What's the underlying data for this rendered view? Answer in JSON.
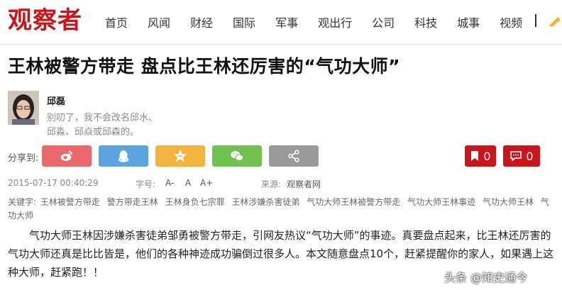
{
  "header": {
    "logo": "观察者",
    "nav": [
      "首页",
      "风闻",
      "财经",
      "国际",
      "军事",
      "观出行",
      "公司",
      "科技",
      "城事",
      "视频"
    ],
    "nav_separator": "|"
  },
  "article": {
    "title": "王林被警方带走 盘点比王林还厉害的“气功大师”",
    "author": {
      "name": "邱磊",
      "bio_line1": "别叨了，我不会改名邱水、",
      "bio_line2": "邱淼、邱焱或邱森的。"
    },
    "share": {
      "label": "分享到:",
      "buttons": [
        {
          "icon": "weibo-icon",
          "color": "#e9686b"
        },
        {
          "icon": "qq-icon",
          "color": "#5ba4e0"
        },
        {
          "icon": "qzone-star-icon",
          "color": "#f3b33f"
        },
        {
          "icon": "wechat-icon",
          "color": "#6fc24f"
        },
        {
          "icon": "share-icon",
          "color": "#9a9a9a"
        }
      ],
      "bookmark_count": "0",
      "comment_count": "0"
    },
    "meta": {
      "date": "2015-07-17 00:40:29",
      "font_label": "字号:",
      "font_small": "A-",
      "font_normal": "A",
      "font_large": "A+",
      "source_label": "来源:",
      "source": "观察者网"
    },
    "keywords": {
      "label": "关键字:",
      "items": [
        "王林被警方带走",
        "警方带走王林",
        "王林身负七宗罪",
        "王林涉嫌杀害徒弟",
        "气功大师王林被警方带走",
        "气功大师王林事迹",
        "气功大师王林",
        "气功大师"
      ]
    },
    "body": "气功大师王林因涉嫌杀害徒弟邹勇被警方带走，引网友热议“气功大师”的事迹。真要盘点起来，比王林还厉害的气功大师还真是比比皆是，他们的各种神迹成功骗倒过很多人。本文随意盘点10个，赶紧提醒你的家人，如果遇上这种大师，赶紧跑！！"
  },
  "watermark": "头条 @知史通今",
  "colors": {
    "brand_red": "#c8161d"
  }
}
